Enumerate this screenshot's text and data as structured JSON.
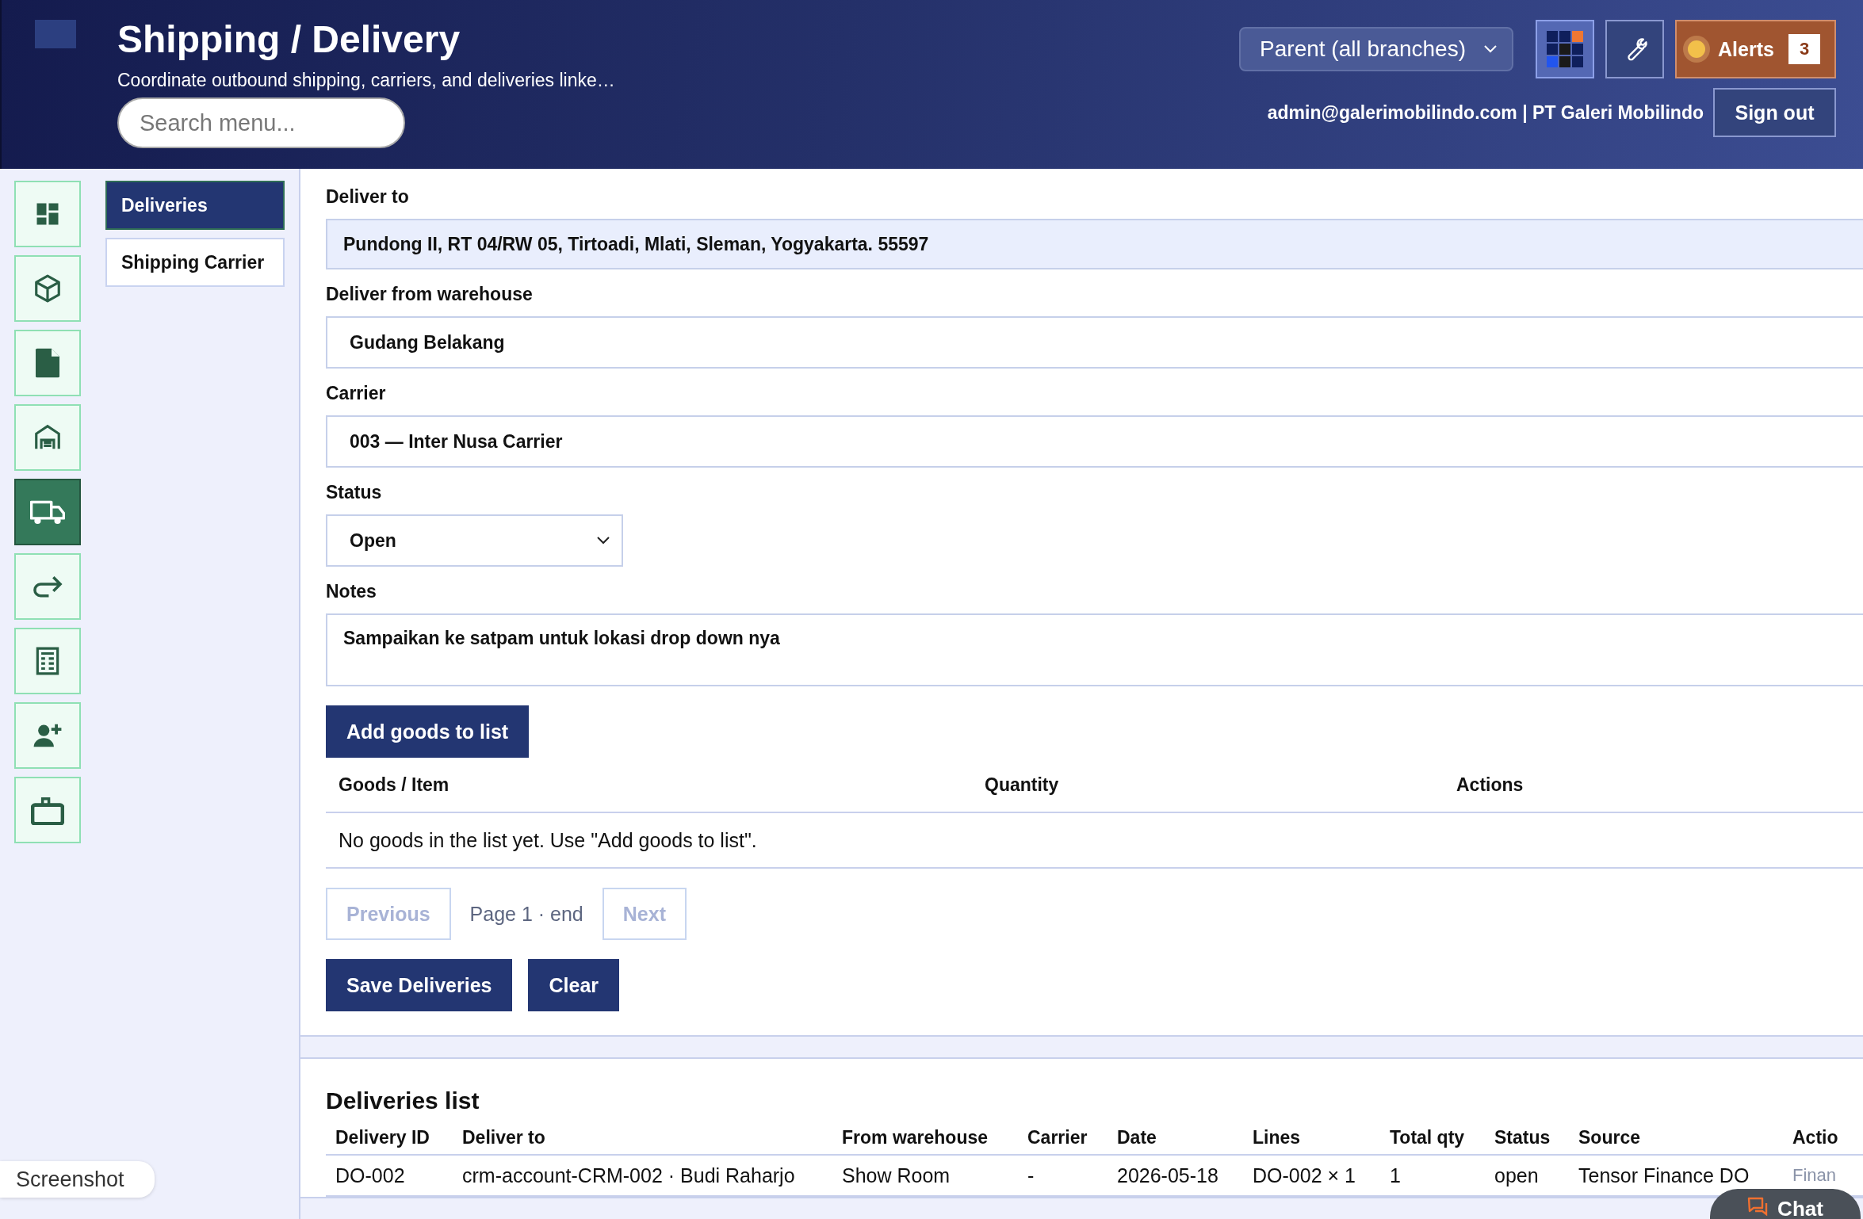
{
  "header": {
    "title": "Shipping / Delivery",
    "subtitle": "Coordinate outbound shipping, carriers, and deliveries linke…",
    "search": {
      "placeholder": "Search menu..."
    },
    "branch": "Parent (all branches)",
    "alerts": {
      "label": "Alerts",
      "count": "3"
    },
    "user": "admin@galerimobilindo.com | PT Galeri Mobilindo",
    "sign_out": "Sign out"
  },
  "rail": [
    {
      "kind": "dashboard",
      "selected": false
    },
    {
      "kind": "box",
      "selected": false
    },
    {
      "kind": "document",
      "selected": false
    },
    {
      "kind": "warehouse",
      "selected": false
    },
    {
      "kind": "truck",
      "selected": true
    },
    {
      "kind": "return",
      "selected": false
    },
    {
      "kind": "calculator",
      "selected": false
    },
    {
      "kind": "person-add",
      "selected": false
    },
    {
      "kind": "briefcase",
      "selected": false
    }
  ],
  "subnav": [
    {
      "label": "Deliveries",
      "selected": true
    },
    {
      "label": "Shipping Carrier",
      "selected": false
    }
  ],
  "form": {
    "deliver_to": {
      "label": "Deliver to",
      "value": "Pundong II, RT 04/RW 05, Tirtoadi, Mlati, Sleman, Yogyakarta. 55597"
    },
    "warehouse": {
      "label": "Deliver from warehouse",
      "value": "Gudang Belakang"
    },
    "carrier": {
      "label": "Carrier",
      "value": "003 — Inter Nusa Carrier"
    },
    "status": {
      "label": "Status",
      "value": "Open"
    },
    "notes": {
      "label": "Notes",
      "value": "Sampaikan ke satpam untuk lokasi drop down nya"
    }
  },
  "add_goods": "Add goods to list",
  "goods_table": {
    "columns": [
      "Goods / Item",
      "Quantity",
      "Actions"
    ],
    "empty": "No goods in the list yet. Use \"Add goods to list\"."
  },
  "pagination": {
    "previous": {
      "label": "Previous",
      "disabled": true
    },
    "page": "Page 1 · end",
    "next": {
      "label": "Next",
      "disabled": true
    }
  },
  "actions": [
    "Save Deliveries",
    "Clear"
  ],
  "deliveries_list": {
    "title": "Deliveries list",
    "columns": [
      "Delivery ID",
      "Deliver to",
      "From warehouse",
      "Carrier",
      "Date",
      "Lines",
      "Total qty",
      "Status",
      "Source",
      "Actio"
    ],
    "rows": [
      [
        "DO-002",
        "crm-account-CRM-002 · Budi Raharjo",
        "Show Room",
        "-",
        "2026-05-18",
        "DO-002 × 1",
        "1",
        "open",
        "Tensor Finance DO",
        "Finan"
      ]
    ]
  },
  "chat": "Chat",
  "tooltip": "Screenshot"
}
